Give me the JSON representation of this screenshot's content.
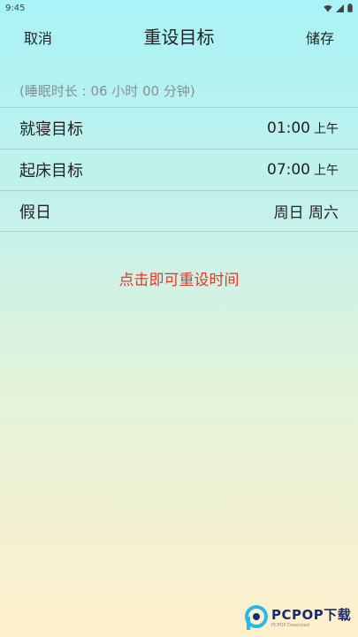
{
  "status_bar": {
    "time": "9:45"
  },
  "nav": {
    "cancel_label": "取消",
    "title": "重设目标",
    "save_label": "储存"
  },
  "sleep_duration": "(睡眠时长 : 06 小时 00 分钟)",
  "settings": [
    {
      "label": "就寝目标",
      "time": "01:00",
      "ampm": "上午"
    },
    {
      "label": "起床目标",
      "time": "07:00",
      "ampm": "上午"
    },
    {
      "label": "假日",
      "value": "周日 周六"
    }
  ],
  "hint": "点击即可重设时间",
  "watermark": {
    "brand": "PCPOP下载",
    "sub": "PCPOP Download"
  },
  "colors": {
    "hint": "#e03a2a",
    "divider": "#a9cfd3",
    "muted_text": "#8a8f92",
    "watermark_blue": "#1a2a6c",
    "watermark_cyan": "#2ab8e6"
  },
  "icons": [
    "wifi-icon",
    "signal-icon",
    "battery-icon",
    "pcpop-logo-icon"
  ]
}
